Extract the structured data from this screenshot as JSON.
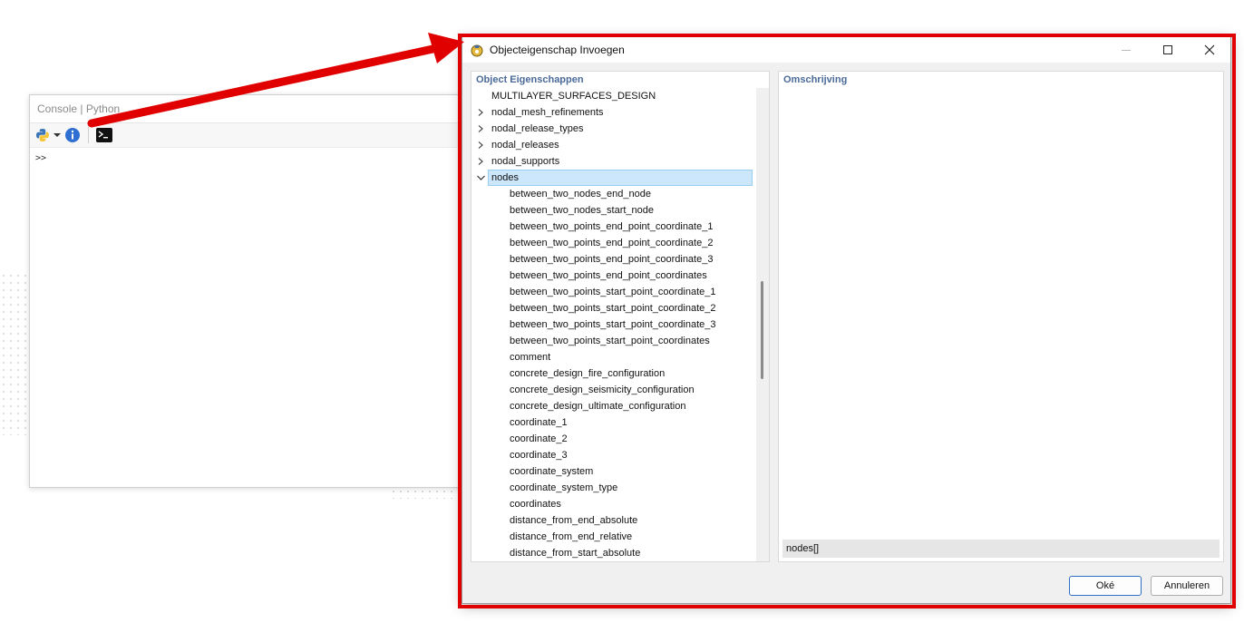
{
  "console": {
    "title": "Console | Python",
    "prompt": ">>",
    "icons": [
      "python-icon",
      "dropdown-arrow-icon",
      "info-icon",
      "terminal-icon"
    ]
  },
  "dialog": {
    "title": "Objecteigenschap Invoegen",
    "left_header": "Object Eigenschappen",
    "right_header": "Omschrijving",
    "expression": "nodes[]",
    "ok_label": "Oké",
    "cancel_label": "Annuleren",
    "tree_top": [
      {
        "label": "MULTILAYER_SURFACES_DESIGN",
        "expander": "none"
      },
      {
        "label": "nodal_mesh_refinements",
        "expander": "collapsed"
      },
      {
        "label": "nodal_release_types",
        "expander": "collapsed"
      },
      {
        "label": "nodal_releases",
        "expander": "collapsed"
      },
      {
        "label": "nodal_supports",
        "expander": "collapsed"
      },
      {
        "label": "nodes",
        "expander": "expanded"
      }
    ],
    "tree_children": [
      "between_two_nodes_end_node",
      "between_two_nodes_start_node",
      "between_two_points_end_point_coordinate_1",
      "between_two_points_end_point_coordinate_2",
      "between_two_points_end_point_coordinate_3",
      "between_two_points_end_point_coordinates",
      "between_two_points_start_point_coordinate_1",
      "between_two_points_start_point_coordinate_2",
      "between_two_points_start_point_coordinate_3",
      "between_two_points_start_point_coordinates",
      "comment",
      "concrete_design_fire_configuration",
      "concrete_design_seismicity_configuration",
      "concrete_design_ultimate_configuration",
      "coordinate_1",
      "coordinate_2",
      "coordinate_3",
      "coordinate_system",
      "coordinate_system_type",
      "coordinates",
      "distance_from_end_absolute",
      "distance_from_end_relative",
      "distance_from_start_absolute"
    ]
  },
  "colors": {
    "highlight": "#e10000",
    "header_text": "#4a6a99",
    "selection": "#cce6fb"
  }
}
